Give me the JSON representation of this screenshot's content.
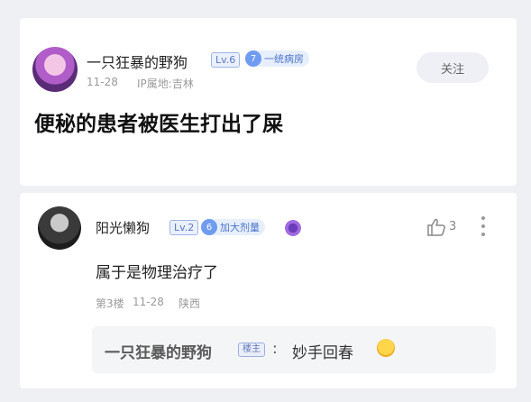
{
  "post": {
    "author": "一只狂暴的野狗",
    "level": "Lv.6",
    "fan_level": "7",
    "fan_title": "一统病房",
    "date": "11-28",
    "ip": "IP属地:吉林",
    "follow_label": "关注",
    "body": "便秘的患者被医生打出了屎"
  },
  "comment": {
    "author": "阳光懒狗",
    "level": "Lv.2",
    "fan_level": "6",
    "fan_title": "加大剂量",
    "like_count": "3",
    "body": "属于是物理治疗了",
    "floor": "第3楼",
    "date": "11-28",
    "location": "陕西",
    "reply": {
      "author": "一只狂暴的野狗",
      "tag": "楼主",
      "colon": ":",
      "text": "妙手回春"
    }
  },
  "colors": {
    "background": "#eef0f3",
    "card": "#ffffff",
    "level_badge": "#5a77c2",
    "fan_badge": "#6f9cf0"
  }
}
